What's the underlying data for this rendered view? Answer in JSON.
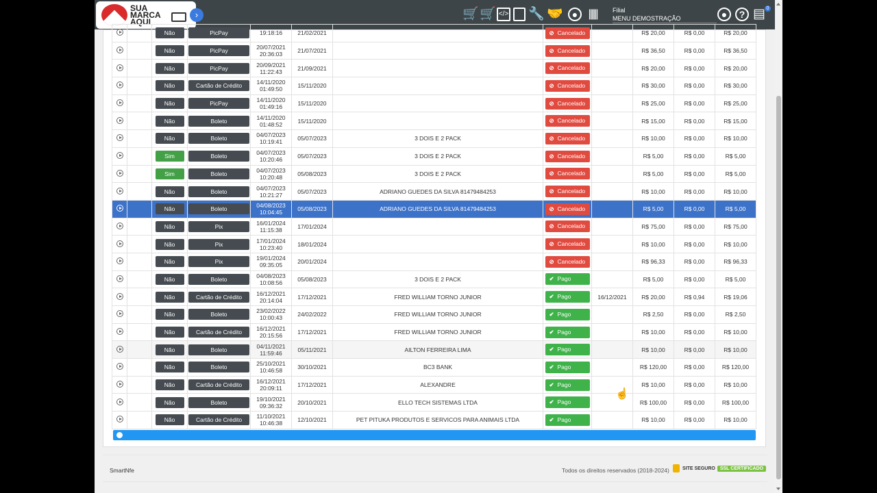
{
  "header": {
    "logo_text": [
      "SUA",
      "MARCA",
      "AQUI"
    ],
    "branch_label": "Filial",
    "branch_value": "MENU DEMOSTRAÇÃO",
    "notification_count": "0"
  },
  "rows": [
    {
      "sent": "Não",
      "method": "PicPay",
      "created": [
        "",
        "19:18:16"
      ],
      "due": "21/02/2021",
      "client": "",
      "status": "Cancelado",
      "paid_on": "",
      "value": "R$ 20,00",
      "fee": "R$ 0,00",
      "net": "R$ 20,00"
    },
    {
      "sent": "Não",
      "method": "PicPay",
      "created": [
        "20/07/2021",
        "20:36:03"
      ],
      "due": "21/07/2021",
      "client": "",
      "status": "Cancelado",
      "paid_on": "",
      "value": "R$ 36,50",
      "fee": "R$ 0,00",
      "net": "R$ 36,50"
    },
    {
      "sent": "Não",
      "method": "PicPay",
      "created": [
        "20/09/2021",
        "11:22:43"
      ],
      "due": "21/09/2021",
      "client": "",
      "status": "Cancelado",
      "paid_on": "",
      "value": "R$ 20,00",
      "fee": "R$ 0,00",
      "net": "R$ 20,00"
    },
    {
      "sent": "Não",
      "method": "Cartão de Crédito",
      "created": [
        "14/11/2020",
        "01:49:50"
      ],
      "due": "15/11/2020",
      "client": "",
      "status": "Cancelado",
      "paid_on": "",
      "value": "R$ 30,00",
      "fee": "R$ 0,00",
      "net": "R$ 30,00"
    },
    {
      "sent": "Não",
      "method": "PicPay",
      "created": [
        "14/11/2020",
        "01:49:16"
      ],
      "due": "15/11/2020",
      "client": "",
      "status": "Cancelado",
      "paid_on": "",
      "value": "R$ 25,00",
      "fee": "R$ 0,00",
      "net": "R$ 25,00"
    },
    {
      "sent": "Não",
      "method": "Boleto",
      "created": [
        "14/11/2020",
        "01:48:52"
      ],
      "due": "15/11/2020",
      "client": "",
      "status": "Cancelado",
      "paid_on": "",
      "value": "R$ 15,00",
      "fee": "R$ 0,00",
      "net": "R$ 15,00"
    },
    {
      "sent": "Não",
      "method": "Boleto",
      "created": [
        "04/07/2023",
        "10:19:41"
      ],
      "due": "05/07/2023",
      "client": "3 DOIS E 2 PACK",
      "status": "Cancelado",
      "paid_on": "",
      "value": "R$ 10,00",
      "fee": "R$ 0,00",
      "net": "R$ 10,00"
    },
    {
      "sent": "Sim",
      "method": "Boleto",
      "created": [
        "04/07/2023",
        "10:20:46"
      ],
      "due": "05/07/2023",
      "client": "3 DOIS E 2 PACK",
      "status": "Cancelado",
      "paid_on": "",
      "value": "R$ 5,00",
      "fee": "R$ 0,00",
      "net": "R$ 5,00"
    },
    {
      "sent": "Sim",
      "method": "Boleto",
      "created": [
        "04/07/2023",
        "10:20:48"
      ],
      "due": "05/08/2023",
      "client": "3 DOIS E 2 PACK",
      "status": "Cancelado",
      "paid_on": "",
      "value": "R$ 5,00",
      "fee": "R$ 0,00",
      "net": "R$ 5,00"
    },
    {
      "sent": "Não",
      "method": "Boleto",
      "created": [
        "04/07/2023",
        "10:21:27"
      ],
      "due": "05/07/2023",
      "client": "ADRIANO GUEDES DA SILVA 81479484253",
      "status": "Cancelado",
      "paid_on": "",
      "value": "R$ 10,00",
      "fee": "R$ 0,00",
      "net": "R$ 10,00"
    },
    {
      "sent": "Não",
      "method": "Boleto",
      "created": [
        "04/08/2023",
        "10:04:45"
      ],
      "due": "05/08/2023",
      "client": "ADRIANO GUEDES DA SILVA 81479484253",
      "status": "Cancelado",
      "paid_on": "",
      "value": "R$ 5,00",
      "fee": "R$ 0,00",
      "net": "R$ 5,00",
      "selected": true
    },
    {
      "sent": "Não",
      "method": "Pix",
      "created": [
        "16/01/2024",
        "11:15:38"
      ],
      "due": "17/01/2024",
      "client": "",
      "status": "Cancelado",
      "paid_on": "",
      "value": "R$ 75,00",
      "fee": "R$ 0,00",
      "net": "R$ 75,00"
    },
    {
      "sent": "Não",
      "method": "Pix",
      "created": [
        "17/01/2024",
        "10:23:40"
      ],
      "due": "18/01/2024",
      "client": "",
      "status": "Cancelado",
      "paid_on": "",
      "value": "R$ 10,00",
      "fee": "R$ 0,00",
      "net": "R$ 10,00"
    },
    {
      "sent": "Não",
      "method": "Pix",
      "created": [
        "19/01/2024",
        "09:35:05"
      ],
      "due": "20/01/2024",
      "client": "",
      "status": "Cancelado",
      "paid_on": "",
      "value": "R$ 96,33",
      "fee": "R$ 0,00",
      "net": "R$ 96,33"
    },
    {
      "sent": "Não",
      "method": "Boleto",
      "created": [
        "04/08/2023",
        "10:08:56"
      ],
      "due": "05/08/2023",
      "client": "3 DOIS E 2 PACK",
      "status": "Pago",
      "paid_on": "",
      "value": "R$ 5,00",
      "fee": "R$ 0,00",
      "net": "R$ 5,00"
    },
    {
      "sent": "Não",
      "method": "Cartão de Crédito",
      "created": [
        "16/12/2021",
        "20:14:04"
      ],
      "due": "17/12/2021",
      "client": "FRED WILLIAM TORNO JUNIOR",
      "status": "Pago",
      "paid_on": "16/12/2021",
      "value": "R$ 20,00",
      "fee": "R$ 0,94",
      "net": "R$ 19,06"
    },
    {
      "sent": "Não",
      "method": "Boleto",
      "created": [
        "23/02/2022",
        "10:00:43"
      ],
      "due": "24/02/2022",
      "client": "FRED WILLIAM TORNO JUNIOR",
      "status": "Pago",
      "paid_on": "",
      "value": "R$ 2,50",
      "fee": "R$ 0,00",
      "net": "R$ 2,50"
    },
    {
      "sent": "Não",
      "method": "Cartão de Crédito",
      "created": [
        "16/12/2021",
        "20:15:56"
      ],
      "due": "17/12/2021",
      "client": "FRED WILLIAM TORNO JUNIOR",
      "status": "Pago",
      "paid_on": "",
      "value": "R$ 10,00",
      "fee": "R$ 0,00",
      "net": "R$ 10,00"
    },
    {
      "sent": "Não",
      "method": "Boleto",
      "created": [
        "04/11/2021",
        "11:59:46"
      ],
      "due": "05/11/2021",
      "client": "AILTON FERREIRA LIMA",
      "status": "Pago",
      "paid_on": "",
      "value": "R$ 10,00",
      "fee": "R$ 0,00",
      "net": "R$ 10,00",
      "alt": true
    },
    {
      "sent": "Não",
      "method": "Boleto",
      "created": [
        "25/10/2021",
        "10:46:58"
      ],
      "due": "30/10/2021",
      "client": "BC3 BANK",
      "status": "Pago",
      "paid_on": "",
      "value": "R$ 120,00",
      "fee": "R$ 0,00",
      "net": "R$ 120,00"
    },
    {
      "sent": "Não",
      "method": "Cartão de Crédito",
      "created": [
        "16/12/2021",
        "20:09:11"
      ],
      "due": "17/12/2021",
      "client": "ALEXANDRE",
      "status": "Pago",
      "paid_on": "",
      "value": "R$ 10,00",
      "fee": "R$ 0,00",
      "net": "R$ 10,00"
    },
    {
      "sent": "Não",
      "method": "Boleto",
      "created": [
        "19/10/2021",
        "09:36:32"
      ],
      "due": "20/10/2021",
      "client": "ELLO TECH SISTEMAS LTDA",
      "status": "Pago",
      "paid_on": "",
      "value": "R$ 100,00",
      "fee": "R$ 0,00",
      "net": "R$ 100,00"
    },
    {
      "sent": "Não",
      "method": "Cartão de Crédito",
      "created": [
        "11/10/2021",
        "10:46:38"
      ],
      "due": "12/10/2021",
      "client": "PET PITUKA PRODUTOS E SERVICOS PARA ANIMAIS LTDA",
      "status": "Pago",
      "paid_on": "",
      "value": "R$ 10,00",
      "fee": "R$ 0,00",
      "net": "R$ 10,00"
    }
  ],
  "footer": {
    "brand": "SmartNfe",
    "rights": "Todos os direitos reservados (2018-2024)",
    "secure": "SITE SEGURO",
    "ssl": "SSL CERTIFICADO"
  },
  "colors": {
    "header": "#3d4548",
    "cancel": "#e04a3f",
    "paid": "#3fb24a",
    "selected": "#3d72c9",
    "progress": "#2196f3"
  }
}
